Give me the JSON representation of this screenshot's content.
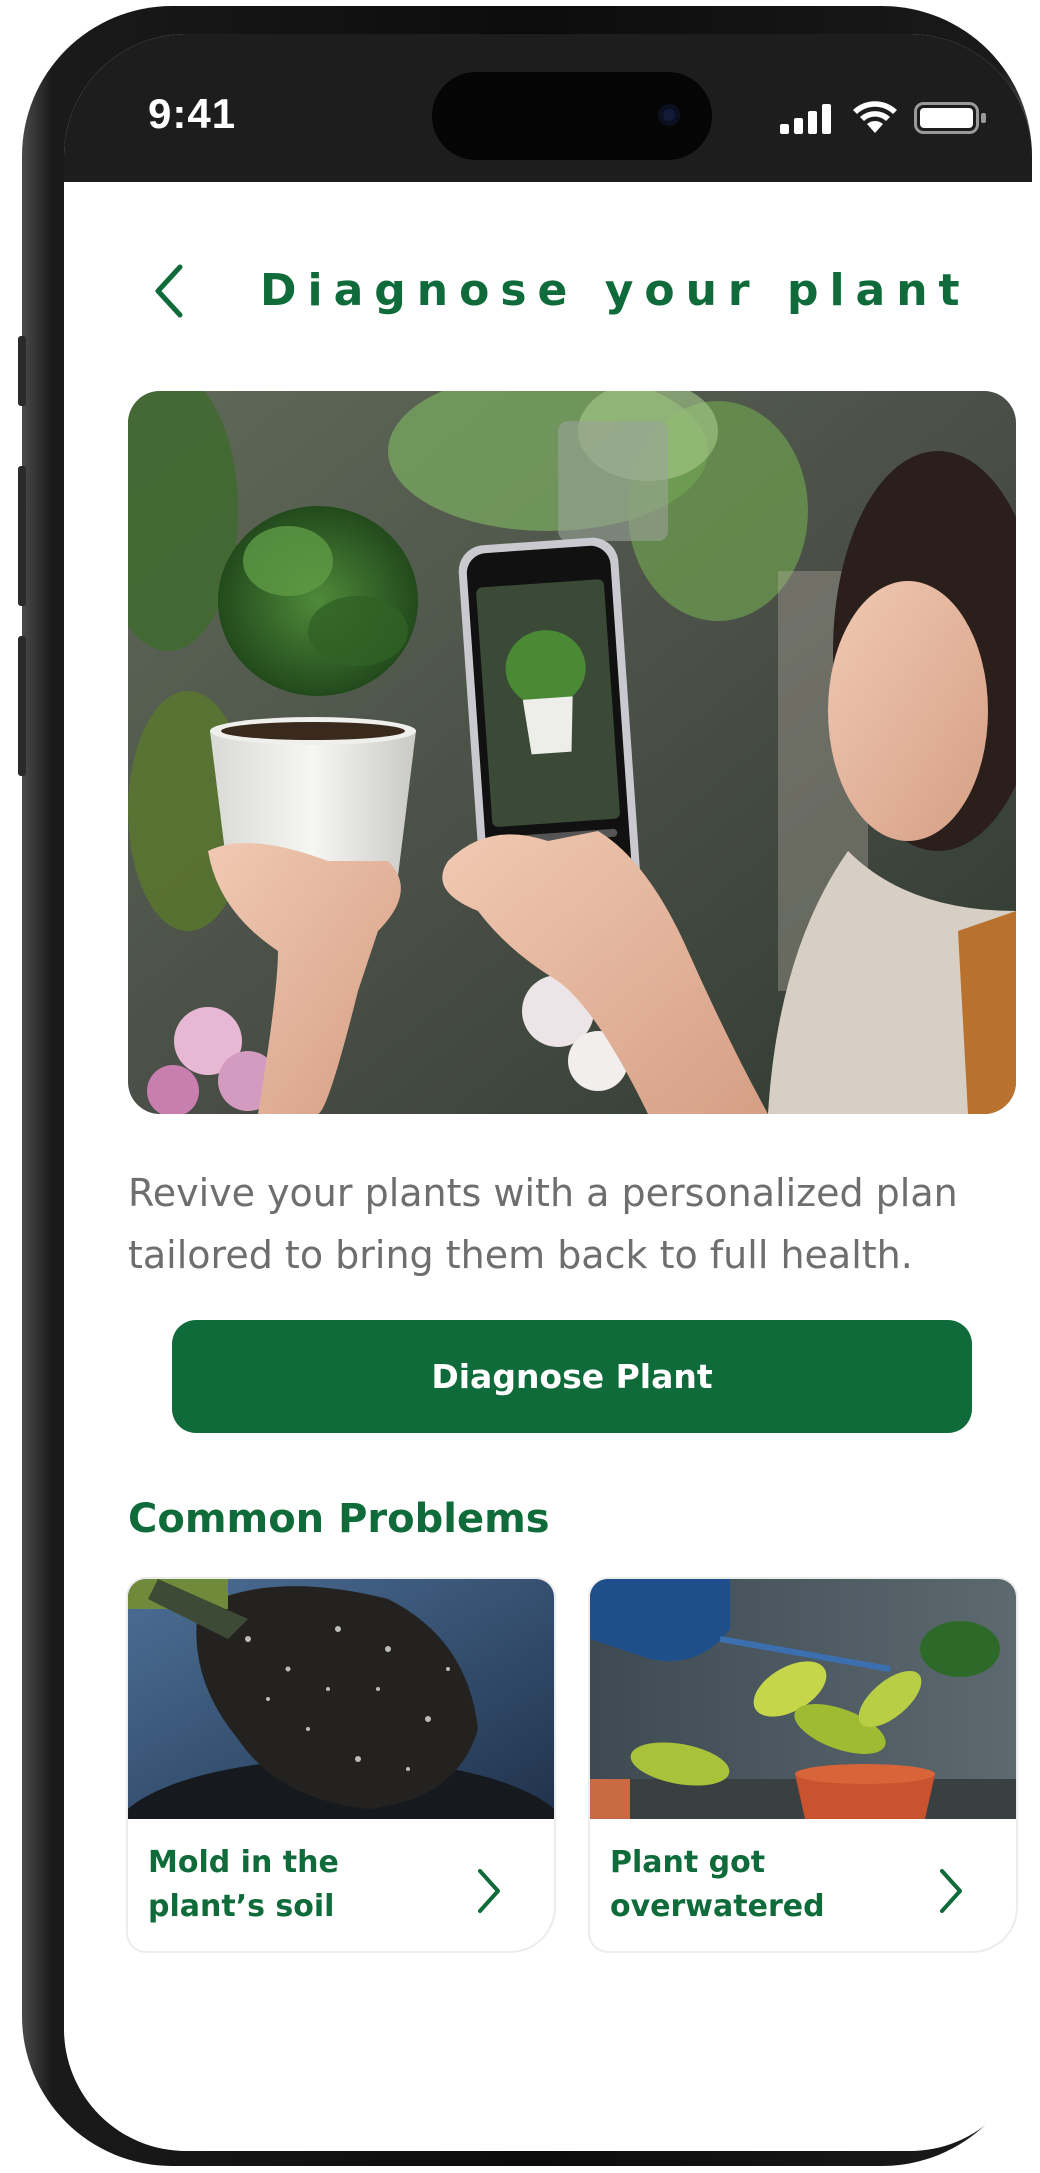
{
  "status_bar": {
    "time": "9:41",
    "icons": [
      "cellular-signal-icon",
      "wifi-icon",
      "battery-icon"
    ]
  },
  "header": {
    "back_icon": "chevron-left-icon",
    "title": "Diagnose your plant"
  },
  "hero_image": {
    "subject": "woman photographing a potted plant with a phone"
  },
  "description": "Revive your plants with a personalized plan tailored to bring them back to full health.",
  "cta": {
    "label": "Diagnose Plant"
  },
  "common_problems": {
    "title": "Common Problems",
    "cards": [
      {
        "line1": "Mold in the",
        "line2": "plant’s soil",
        "icon": "chevron-right-icon"
      },
      {
        "line1": "Plant got",
        "line2": "overwatered",
        "icon": "chevron-right-icon"
      }
    ]
  },
  "colors": {
    "brand_green": "#0f6b3a",
    "body_text": "#6e6e6e",
    "status_bar_bg": "#1d1d1d"
  }
}
